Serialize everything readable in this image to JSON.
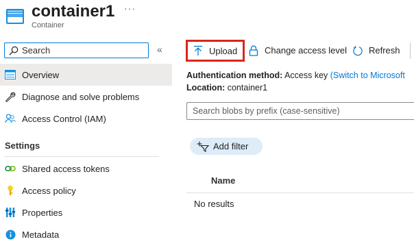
{
  "header": {
    "title": "container1",
    "subtitle": "Container",
    "more": "···"
  },
  "sidebar": {
    "search_placeholder": "Search",
    "collapse": "«",
    "items": [
      {
        "label": "Overview",
        "icon": "overview-icon",
        "selected": true
      },
      {
        "label": "Diagnose and solve problems",
        "icon": "wrench-icon"
      },
      {
        "label": "Access Control (IAM)",
        "icon": "people-icon"
      }
    ],
    "settings_heading": "Settings",
    "settings_items": [
      {
        "label": "Shared access tokens",
        "icon": "link-icon"
      },
      {
        "label": "Access policy",
        "icon": "key-icon"
      },
      {
        "label": "Properties",
        "icon": "properties-icon"
      },
      {
        "label": "Metadata",
        "icon": "info-icon"
      }
    ]
  },
  "toolbar": {
    "upload_label": "Upload",
    "change_access_label": "Change access level",
    "refresh_label": "Refresh"
  },
  "main": {
    "auth_label": "Authentication method:",
    "auth_value": "Access key",
    "auth_link": "(Switch to Microsoft",
    "location_label": "Location:",
    "location_value": "container1",
    "blob_search_placeholder": "Search blobs by prefix (case-sensitive)",
    "add_filter_label": "Add filter",
    "column_name": "Name",
    "no_results": "No results"
  },
  "colors": {
    "accent": "#0078d4",
    "highlight_border": "#d9261c",
    "selected_bg": "#edebe9",
    "filter_bg": "#deecf9"
  }
}
